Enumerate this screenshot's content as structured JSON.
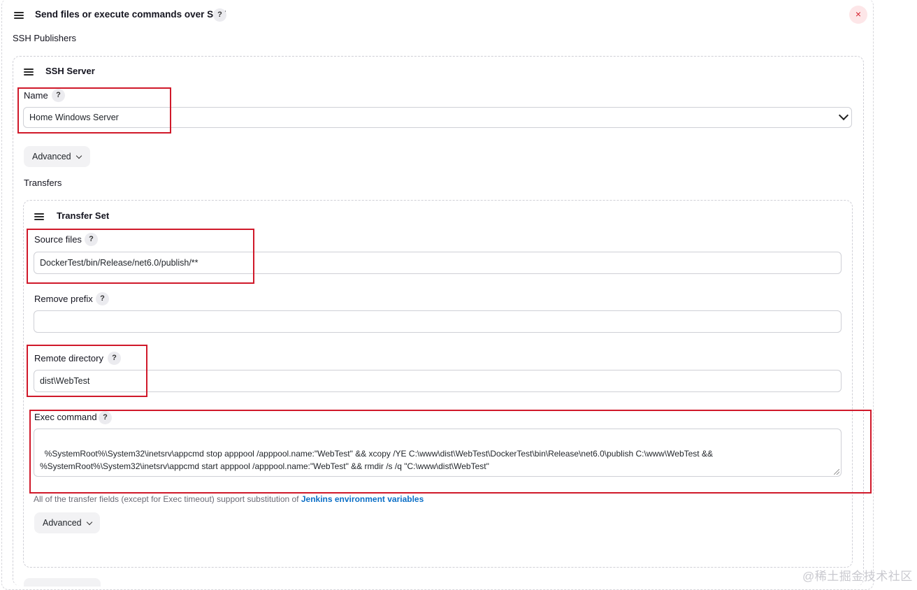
{
  "header": {
    "title": "Send files or execute commands over SSH",
    "help": "?",
    "close_icon": "×"
  },
  "publishers_label": "SSH Publishers",
  "ssh_server": {
    "title": "SSH Server",
    "name_label": "Name",
    "name_value": "Home Windows Server",
    "advanced_label": "Advanced",
    "transfers_label": "Transfers"
  },
  "transfer_set": {
    "title": "Transfer Set",
    "source_files_label": "Source files",
    "source_files_value": "DockerTest/bin/Release/net6.0/publish/**",
    "remove_prefix_label": "Remove prefix",
    "remove_prefix_value": "",
    "remote_directory_label": "Remote directory",
    "remote_directory_value": "dist\\WebTest",
    "exec_command_label": "Exec command",
    "exec_command_value": "%SystemRoot%\\System32\\inetsrv\\appcmd stop apppool /apppool.name:\"WebTest\" && xcopy /YE C:\\www\\dist\\WebTest\\DockerTest\\bin\\Release\\net6.0\\publish C:\\www\\WebTest &&\n%SystemRoot%\\System32\\inetsrv\\appcmd start apppool /apppool.name:\"WebTest\" && rmdir /s /q \"C:\\www\\dist\\WebTest\"",
    "note_text": "All of the transfer fields (except for Exec timeout) support substitution of ",
    "note_link": "Jenkins environment variables",
    "advanced_label": "Advanced"
  },
  "watermark": "@稀土掘金技术社区",
  "colors": {
    "highlight": "#d0192a",
    "link": "#0b6fc7",
    "close": "#d4202c"
  }
}
